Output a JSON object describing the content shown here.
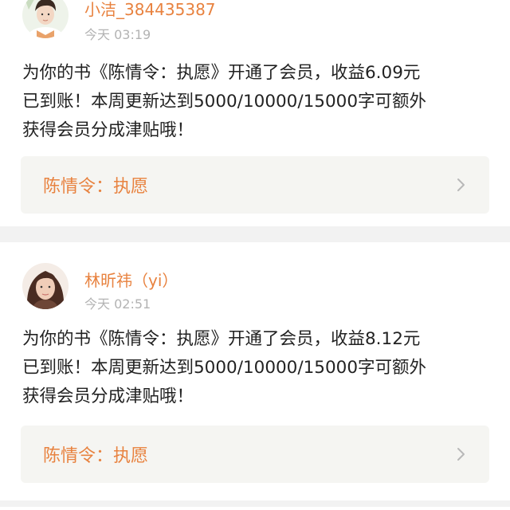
{
  "feed": {
    "items": [
      {
        "username": "小洁_384435387",
        "time": "今天 03:19",
        "message": "为你的书《陈情令：执愿》开通了会员，收益6.09元已到账！本周更新达到5000/10000/15000字可额外获得会员分成津贴哦！",
        "message_lines": [
          "为你的书《陈情令：执愿》开通了会员，收益6.09元",
          "已到账！本周更新达到5000/10000/15000字可额外",
          "获得会员分成津贴哦！"
        ],
        "book_title": "陈情令：执愿",
        "avatar_icon": "male-avatar-icon"
      },
      {
        "username": "林昕祎（yi）",
        "time": "今天 02:51",
        "message": "为你的书《陈情令：执愿》开通了会员，收益8.12元已到账！本周更新达到5000/10000/15000字可额外获得会员分成津贴哦！",
        "message_lines": [
          "为你的书《陈情令：执愿》开通了会员，收益8.12元",
          "已到账！本周更新达到5000/10000/15000字可额外",
          "获得会员分成津贴哦！"
        ],
        "book_title": "陈情令：执愿",
        "avatar_icon": "female-avatar-icon"
      }
    ]
  },
  "colors": {
    "accent": "#e8823f",
    "time_gray": "#b3b3b3",
    "text": "#222222",
    "link_bg": "#f5f5f2",
    "page_bg": "#f2f2f2"
  },
  "icons": {
    "chevron": "chevron-right-icon"
  }
}
